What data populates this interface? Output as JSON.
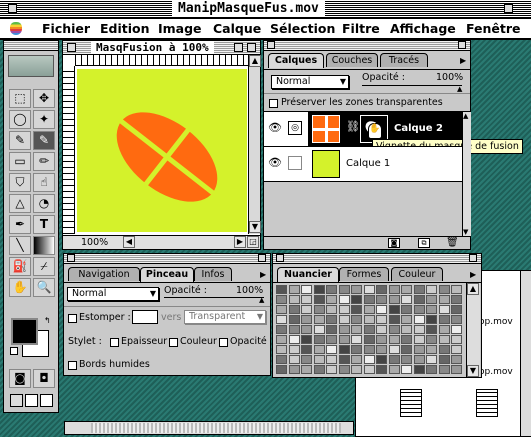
{
  "window": {
    "title": "ManipMasqueFus.mov"
  },
  "menubar": {
    "apple": "",
    "items": [
      "Fichier",
      "Edition",
      "Image",
      "Calque",
      "Sélection",
      "Filtre",
      "Affichage",
      "Fenêtre"
    ]
  },
  "document": {
    "title": "MasqFusion à 100%",
    "zoom": "100%",
    "background_color": "#d4f22b",
    "shape_color": "#ff6a10"
  },
  "layers_panel": {
    "tabs": [
      "Calques",
      "Couches",
      "Tracés"
    ],
    "blend_mode": "Normal",
    "opacity_label": "Opacité :",
    "opacity_value": "100%",
    "preserve_label": "Préserver les zones transparentes",
    "layers": [
      {
        "name": "Calque 2",
        "selected": true,
        "has_mask": true
      },
      {
        "name": "Calque 1",
        "selected": false,
        "has_mask": false
      }
    ],
    "tooltip": "Vignette du masque de fusion"
  },
  "brush_panel": {
    "tabs": [
      "Navigation",
      "Pinceau",
      "Infos"
    ],
    "mode": "Normal",
    "opacity_label": "Opacité :",
    "opacity_value": "100%",
    "estomper_label": "Estomper :",
    "vers_label": "vers",
    "vers_value": "Transparent",
    "stylet_label": "Stylet :",
    "epaisseur": "Epaisseur",
    "couleur": "Couleur",
    "opacite": "Opacité",
    "bords_humides": "Bords humides"
  },
  "swatches_panel": {
    "tabs": [
      "Nuancier",
      "Formes",
      "Couleur"
    ]
  },
  "finder": {
    "items": [
      "op.mov",
      "op.mov"
    ]
  },
  "colors": {
    "fg": "#000000",
    "bg": "#ffffff",
    "selected_layer": "#000000",
    "desktop": "#1e5f58"
  }
}
